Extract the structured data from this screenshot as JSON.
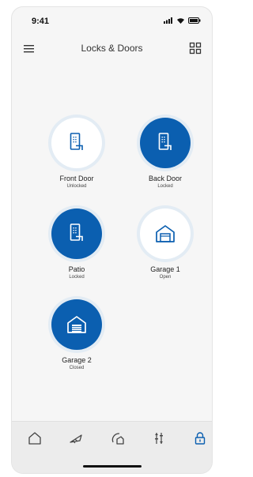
{
  "status_bar": {
    "time": "9:41"
  },
  "header": {
    "title": "Locks & Doors"
  },
  "devices": [
    {
      "name": "Front Door",
      "status": "Unlocked",
      "icon": "door-lock-icon"
    },
    {
      "name": "Back Door",
      "status": "Locked",
      "icon": "door-lock-icon"
    },
    {
      "name": "Patio",
      "status": "Locked",
      "icon": "door-lock-icon"
    },
    {
      "name": "Garage 1",
      "status": "Open",
      "icon": "garage-icon"
    },
    {
      "name": "Garage 2",
      "status": "Closed",
      "icon": "garage-icon"
    }
  ],
  "bottom_nav": {
    "items": [
      "home-icon",
      "shortcuts-icon",
      "climate-icon",
      "sliders-icon",
      "lock-icon"
    ],
    "active": "lock-icon"
  },
  "colors": {
    "accent": "#0b5fb0",
    "ring": "#e3ecf4",
    "background": "#f6f6f6"
  }
}
